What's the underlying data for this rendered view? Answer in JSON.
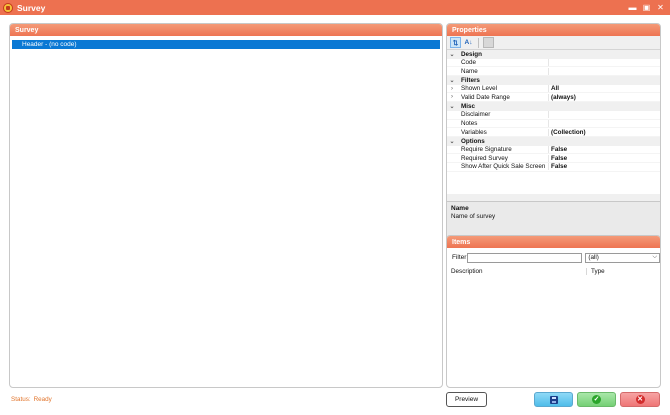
{
  "window": {
    "title": "Survey",
    "controls": {
      "minimize": "▬",
      "maximize": "▣",
      "close": "✕"
    }
  },
  "survey_panel": {
    "title": "Survey",
    "tree": [
      {
        "label": "Header - (no code)",
        "selected": true
      }
    ]
  },
  "properties_panel": {
    "title": "Properties",
    "toolbar": {
      "categorized": "⇅",
      "alphabetical": "A↓",
      "property_pages": ""
    },
    "grid": [
      {
        "kind": "category",
        "name": "Design",
        "expanded": true
      },
      {
        "kind": "prop",
        "name": "Code",
        "value": ""
      },
      {
        "kind": "prop",
        "name": "Name",
        "value": ""
      },
      {
        "kind": "category",
        "name": "Filters",
        "expanded": true
      },
      {
        "kind": "prop",
        "name": "Shown Level",
        "value": "All",
        "expandable": true
      },
      {
        "kind": "prop",
        "name": "Valid Date Range",
        "value": "(always)",
        "expandable": true
      },
      {
        "kind": "category",
        "name": "Misc",
        "expanded": true
      },
      {
        "kind": "prop",
        "name": "Disclaimer",
        "value": ""
      },
      {
        "kind": "prop",
        "name": "Notes",
        "value": ""
      },
      {
        "kind": "prop",
        "name": "Variables",
        "value": "(Collection)"
      },
      {
        "kind": "category",
        "name": "Options",
        "expanded": true
      },
      {
        "kind": "prop",
        "name": "Require Signature",
        "value": "False"
      },
      {
        "kind": "prop",
        "name": "Required Survey",
        "value": "False"
      },
      {
        "kind": "prop",
        "name": "Show After Quick Sale Screen",
        "value": "False"
      }
    ],
    "description": {
      "title": "Name",
      "text": "Name of survey"
    }
  },
  "items_panel": {
    "title": "Items",
    "filter_label": "Filter",
    "filter_value": "",
    "select_value": "(all)",
    "columns": [
      "Description",
      "Type"
    ]
  },
  "status": {
    "label": "Status:",
    "value": "Ready"
  },
  "buttons": {
    "preview": "Preview"
  },
  "colors": {
    "accent": "#ed7150",
    "selection": "#0a78d4",
    "status": "#e2752c"
  }
}
